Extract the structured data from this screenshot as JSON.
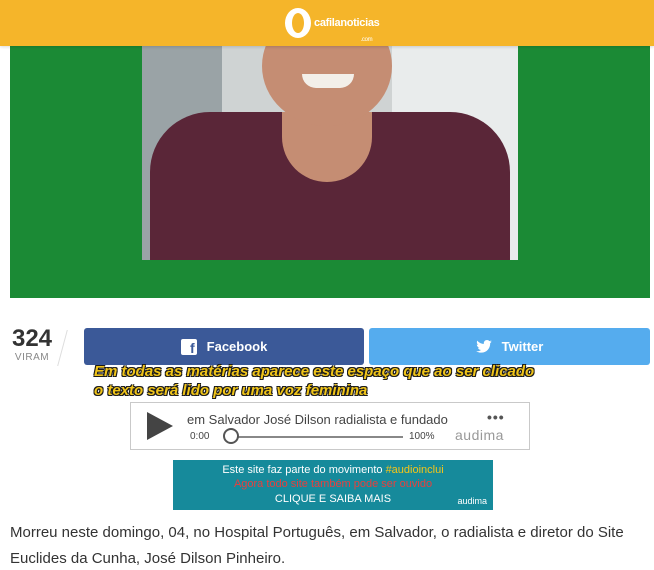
{
  "header": {
    "logo_text": "cafilanoticias",
    "logo_sub": ".com",
    "bg_color": "#f5b52a"
  },
  "hero": {
    "bg_color": "#1b8a35",
    "shirt_color": "#5a2638"
  },
  "views": {
    "count": "324",
    "label": "VIRAM"
  },
  "share": {
    "facebook_label": "Facebook",
    "twitter_label": "Twitter",
    "facebook_color": "#3b5998",
    "twitter_color": "#55acee",
    "facebook_icon": "facebook-icon",
    "twitter_icon": "twitter-bird-icon"
  },
  "annotation": {
    "line1": "Em todas as matérias aparece este espaço que ao ser clicado",
    "line2": "o texto será lido por uma voz feminina",
    "color": "#f0c419"
  },
  "player": {
    "title": "em Salvador José Dilson radialista e fundado",
    "time": "0:00",
    "volume": "100%",
    "menu_icon": "more-dots-icon",
    "brand": "audima",
    "play_icon": "play-icon"
  },
  "banner": {
    "line1_prefix": "Este site faz parte do movimento",
    "line1_tag": "#audioinclui",
    "line2": "Agora todo site também pode ser ouvido",
    "line3": "CLIQUE E SAIBA MAIS",
    "brand": "audima",
    "bg_color": "#168a9b"
  },
  "article": {
    "paragraph": "Morreu neste domingo, 04, no Hospital Português, em Salvador, o radialista e diretor do Site Euclides da Cunha, José Dilson Pinheiro."
  }
}
